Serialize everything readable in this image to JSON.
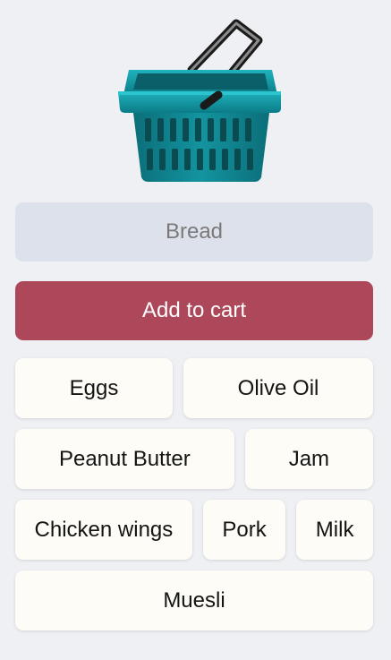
{
  "input": {
    "placeholder": "Bread",
    "value": ""
  },
  "add_button": {
    "label": "Add to cart"
  },
  "cart_items": [
    "Eggs",
    "Olive Oil",
    "Peanut Butter",
    "Jam",
    "Chicken wings",
    "Pork",
    "Milk",
    "Muesli"
  ],
  "colors": {
    "background": "#eef0f4",
    "basket": "#0f8a96",
    "input_bg": "#dde1eb",
    "button_bg": "#ac485a",
    "item_bg": "#fdfcf6"
  },
  "icons": {
    "basket": "shopping-basket-icon"
  }
}
